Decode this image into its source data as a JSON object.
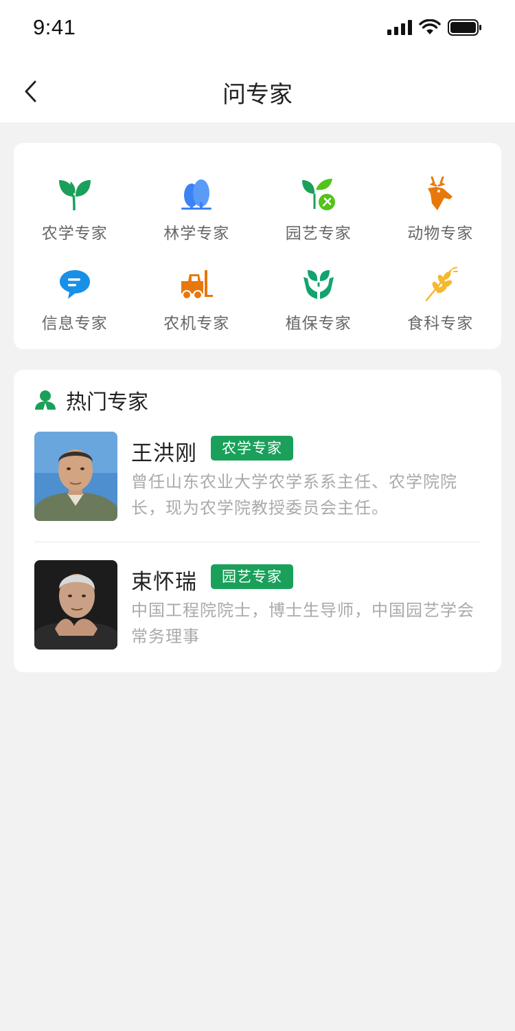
{
  "status_bar": {
    "time": "9:41"
  },
  "nav": {
    "title": "问专家"
  },
  "categories": [
    {
      "label": "农学专家",
      "icon": "sprout-icon",
      "color": "#1aa05a"
    },
    {
      "label": "林学专家",
      "icon": "tree-icon",
      "color": "#3b82f6"
    },
    {
      "label": "园艺专家",
      "icon": "gardening-icon",
      "color": "#52c41a"
    },
    {
      "label": "动物专家",
      "icon": "deer-icon",
      "color": "#e8780c"
    },
    {
      "label": "信息专家",
      "icon": "chat-bubble-icon",
      "color": "#1890e8"
    },
    {
      "label": "农机专家",
      "icon": "forklift-icon",
      "color": "#e8780c"
    },
    {
      "label": "植保专家",
      "icon": "hands-plant-icon",
      "color": "#13a36e"
    },
    {
      "label": "食科专家",
      "icon": "wheat-icon",
      "color": "#f5b82e"
    }
  ],
  "hot": {
    "title": "热门专家",
    "experts": [
      {
        "name": "王洪刚",
        "tag": "农学专家",
        "desc": "曾任山东农业大学农学系系主任、农学院院长，现为农学院教授委员会主任。"
      },
      {
        "name": "束怀瑞",
        "tag": "园艺专家",
        "desc": "中国工程院院士，博士生导师，中国园艺学会常务理事"
      }
    ]
  },
  "colors": {
    "accent": "#1aa05a",
    "background": "#f2f2f2"
  }
}
